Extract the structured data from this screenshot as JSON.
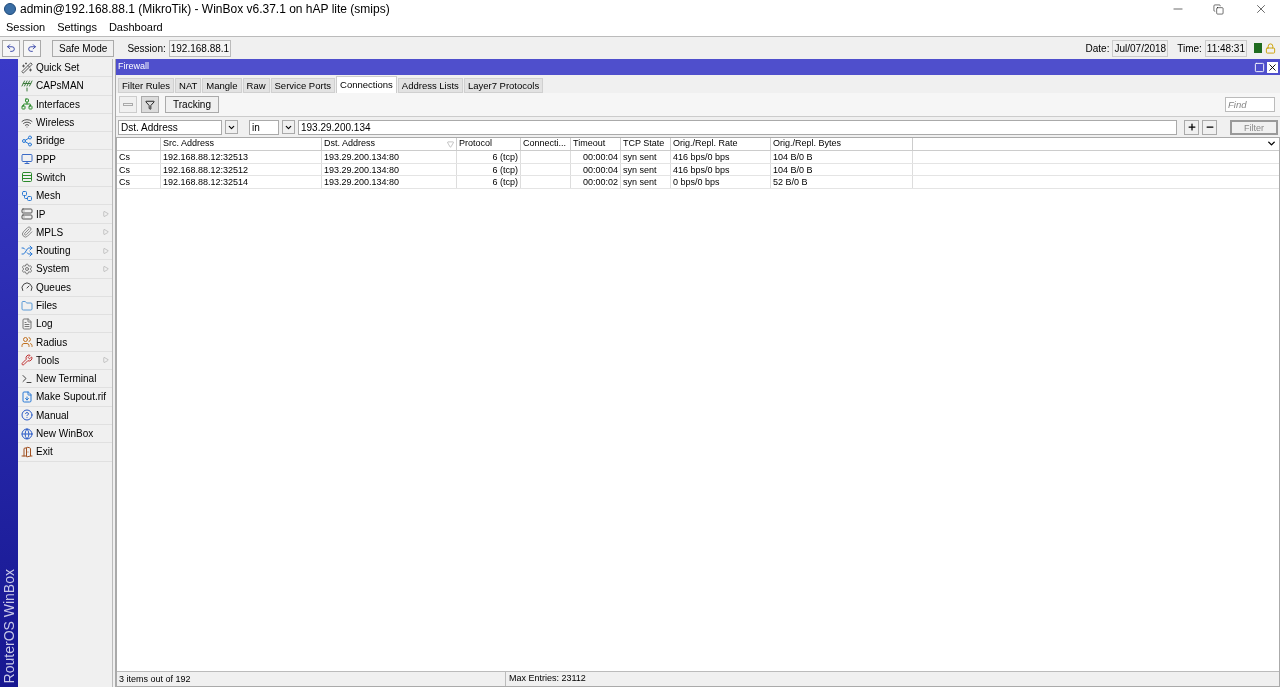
{
  "window": {
    "title": "admin@192.168.88.1 (MikroTik) - WinBox v6.37.1 on hAP lite (smips)"
  },
  "menu": [
    "Session",
    "Settings",
    "Dashboard"
  ],
  "toolbar": {
    "safe_mode": "Safe Mode",
    "session_label": "Session:",
    "session": "192.168.88.1",
    "date_label": "Date:",
    "date": "Jul/07/2018",
    "time_label": "Time:",
    "time": "11:48:31"
  },
  "brand": "RouterOS WinBox",
  "sidebar": {
    "items": [
      {
        "label": "Quick Set",
        "submenu": false
      },
      {
        "label": "CAPsMAN",
        "submenu": false
      },
      {
        "label": "Interfaces",
        "submenu": false
      },
      {
        "label": "Wireless",
        "submenu": false
      },
      {
        "label": "Bridge",
        "submenu": false
      },
      {
        "label": "PPP",
        "submenu": false
      },
      {
        "label": "Switch",
        "submenu": false
      },
      {
        "label": "Mesh",
        "submenu": false
      },
      {
        "label": "IP",
        "submenu": true
      },
      {
        "label": "MPLS",
        "submenu": true
      },
      {
        "label": "Routing",
        "submenu": true
      },
      {
        "label": "System",
        "submenu": true
      },
      {
        "label": "Queues",
        "submenu": false
      },
      {
        "label": "Files",
        "submenu": false
      },
      {
        "label": "Log",
        "submenu": false
      },
      {
        "label": "Radius",
        "submenu": false
      },
      {
        "label": "Tools",
        "submenu": true
      },
      {
        "label": "New Terminal",
        "submenu": false
      },
      {
        "label": "Make Supout.rif",
        "submenu": false
      },
      {
        "label": "Manual",
        "submenu": false
      },
      {
        "label": "New WinBox",
        "submenu": false
      },
      {
        "label": "Exit",
        "submenu": false
      }
    ]
  },
  "firewall": {
    "title": "Firewall",
    "tabs": [
      {
        "label": "Filter Rules",
        "selected": false
      },
      {
        "label": "NAT",
        "selected": false
      },
      {
        "label": "Mangle",
        "selected": false
      },
      {
        "label": "Raw",
        "selected": false
      },
      {
        "label": "Service Ports",
        "selected": false
      },
      {
        "label": "Connections",
        "selected": true
      },
      {
        "label": "Address Lists",
        "selected": false
      },
      {
        "label": "Layer7 Protocols",
        "selected": false
      }
    ],
    "tracking_button": "Tracking",
    "find": {
      "placeholder": "Find"
    },
    "filter": {
      "field": "Dst. Address",
      "operator": "in",
      "value": "193.29.200.134",
      "button": "Filter",
      "button_disabled": true
    },
    "table": {
      "columns": [
        {
          "label": "Src. Address",
          "sorted": false
        },
        {
          "label": "Dst. Address",
          "sorted": true
        },
        {
          "label": "Protocol",
          "sorted": false
        },
        {
          "label": "Connecti...",
          "sorted": false
        },
        {
          "label": "Timeout",
          "sorted": false
        },
        {
          "label": "TCP State",
          "sorted": false
        },
        {
          "label": "Orig./Repl. Rate",
          "sorted": false
        },
        {
          "label": "Orig./Repl. Bytes",
          "sorted": false
        }
      ],
      "rows": [
        {
          "flags": "Cs",
          "src": "192.168.88.12:32513",
          "dst": "193.29.200.134:80",
          "protocol": "6 (tcp)",
          "timeout": "00:00:04",
          "tcp_state": "syn sent",
          "rate": "416 bps/0 bps",
          "bytes": "104 B/0 B"
        },
        {
          "flags": "Cs",
          "src": "192.168.88.12:32512",
          "dst": "193.29.200.134:80",
          "protocol": "6 (tcp)",
          "timeout": "00:00:04",
          "tcp_state": "syn sent",
          "rate": "416 bps/0 bps",
          "bytes": "104 B/0 B"
        },
        {
          "flags": "Cs",
          "src": "192.168.88.12:32514",
          "dst": "193.29.200.134:80",
          "protocol": "6 (tcp)",
          "timeout": "00:00:02",
          "tcp_state": "syn sent",
          "rate": "0 bps/0 bps",
          "bytes": "52 B/0 B"
        }
      ]
    },
    "status": {
      "items": "3 items out of 192",
      "max_entries": "Max Entries: 23112"
    }
  }
}
